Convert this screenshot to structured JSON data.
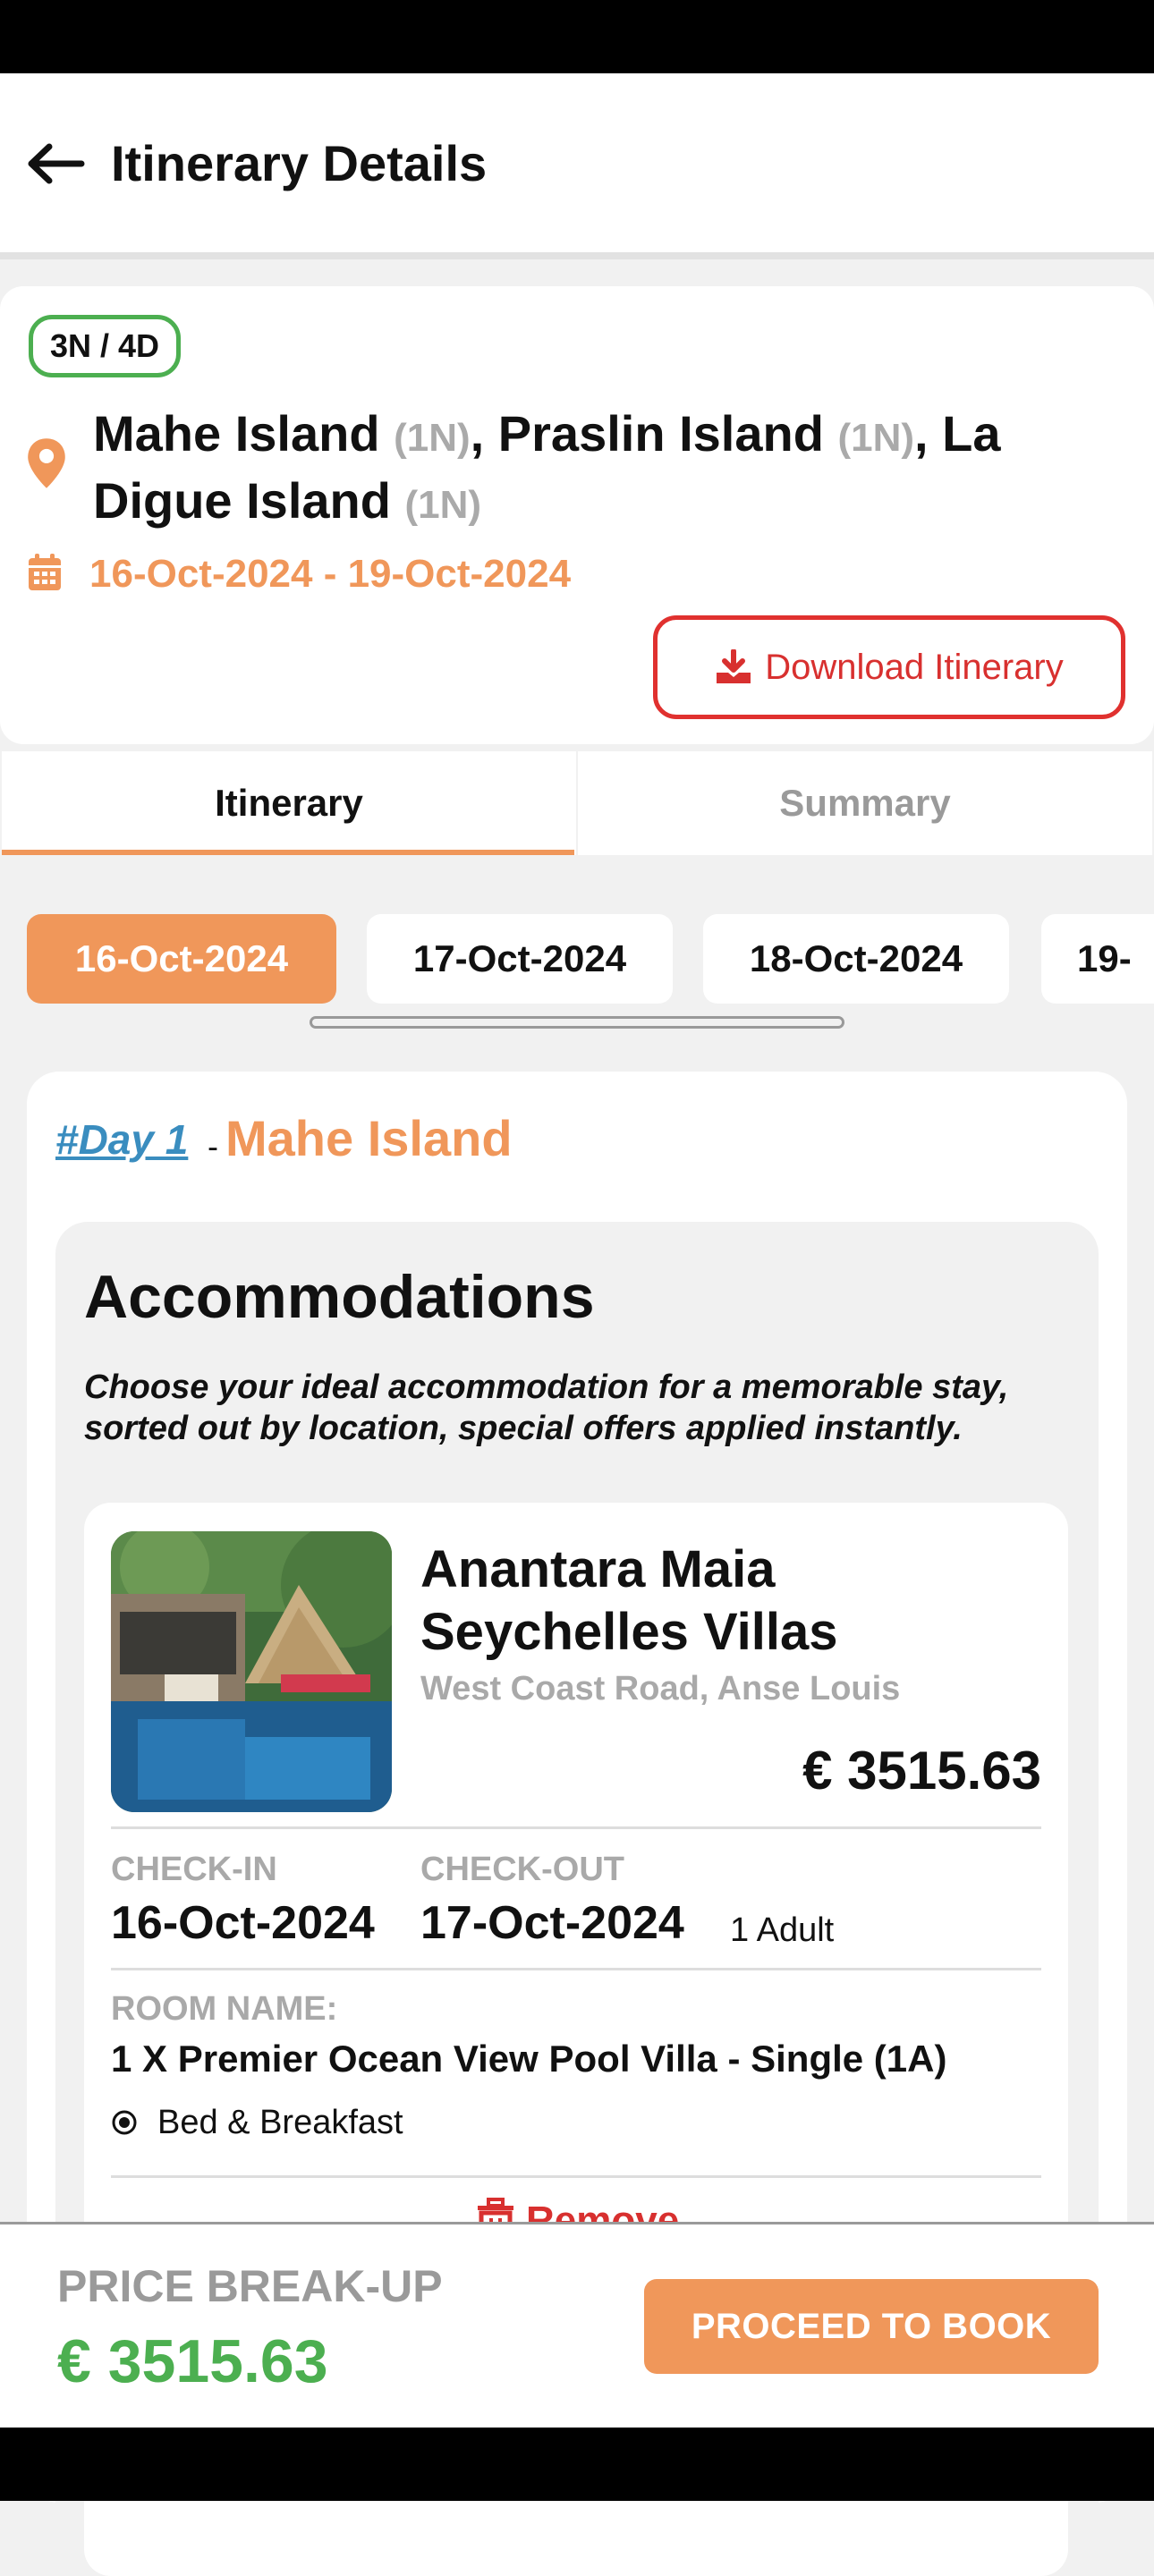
{
  "header": {
    "title": "Itinerary Details"
  },
  "trip": {
    "duration": "3N / 4D",
    "destinations": [
      {
        "name": "Mahe Island",
        "nights": "(1N)",
        "sep": ", "
      },
      {
        "name": "Praslin Island",
        "nights": "(1N)",
        "sep": ", "
      },
      {
        "name": "La Digue Island",
        "nights": "(1N)",
        "sep": ""
      }
    ],
    "dates": "16-Oct-2024 - 19-Oct-2024",
    "download_label": "Download Itinerary"
  },
  "tabs": [
    {
      "label": "Itinerary",
      "active": true
    },
    {
      "label": "Summary",
      "active": false
    }
  ],
  "date_chips": [
    "16-Oct-2024",
    "17-Oct-2024",
    "18-Oct-2024",
    "19-"
  ],
  "day": {
    "link": "#Day 1",
    "sep": "-",
    "place": "Mahe Island"
  },
  "accommodations": {
    "title": "Accommodations",
    "description": "Choose your ideal accommodation for a memorable stay, sorted out by location, special offers applied instantly.",
    "hotel": {
      "name": "Anantara Maia Seychelles Villas",
      "address": "West Coast Road, Anse Louis",
      "price": "€ 3515.63",
      "checkin_label": "CHECK-IN",
      "checkin": "16-Oct-2024",
      "checkout_label": "CHECK-OUT",
      "checkout": "17-Oct-2024",
      "guests": "1 Adult",
      "room_label": "ROOM NAME:",
      "room_name": "1 X Premier Ocean View Pool Villa  - Single (1A)",
      "meal_plan": "Bed & Breakfast",
      "remove_label": "Remove"
    }
  },
  "footer": {
    "price_label": "PRICE BREAK-UP",
    "price": "€ 3515.63",
    "proceed_label": "PROCEED TO BOOK"
  },
  "colors": {
    "accent": "#f0975a",
    "green": "#4caf50",
    "red": "#e0312f",
    "link": "#3a8dbf"
  }
}
